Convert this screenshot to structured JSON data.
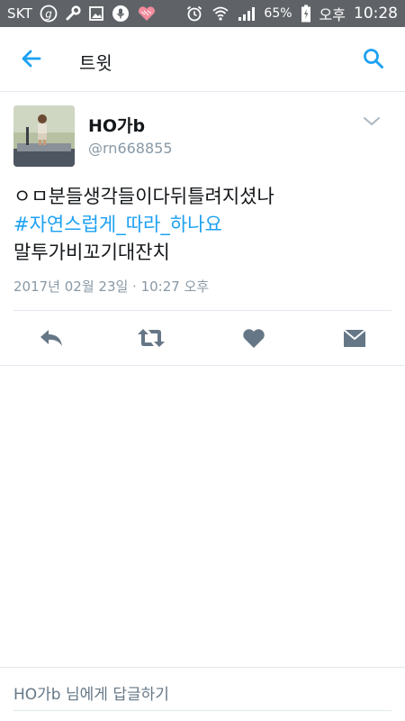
{
  "status_bar": {
    "carrier": "SKT",
    "battery_percent": "65%",
    "ampm": "오후",
    "time": "10:28",
    "icons": [
      "g-circle-icon",
      "wrench-icon",
      "image-icon",
      "mic-icon",
      "heart-icon",
      "alarm-icon",
      "wifi-icon",
      "signal-icon",
      "battery-charging-icon"
    ]
  },
  "app_bar": {
    "title": "트윗",
    "icons": [
      "back-arrow-icon",
      "search-icon"
    ]
  },
  "tweet": {
    "display_name": "HO가b",
    "handle": "@rn668855",
    "text_line1": "ㅇㅁ분들생각들이다뒤틀려지셨나",
    "hashtag": "#자연스럽게_따라_하나요",
    "text_line3": "말투가비꼬기대잔치",
    "timestamp": "2017년 02월 23일 · 10:27 오후",
    "actions": [
      "reply-icon",
      "retweet-icon",
      "like-icon",
      "direct-message-icon"
    ]
  },
  "reply": {
    "placeholder": "HO가b 님에게 답글하기"
  },
  "colors": {
    "status_bar_bg": "#5f6368",
    "accent": "#1da1f2",
    "secondary_text": "#8899a6",
    "action_icon": "#657786",
    "divider": "#e1e8ed"
  }
}
